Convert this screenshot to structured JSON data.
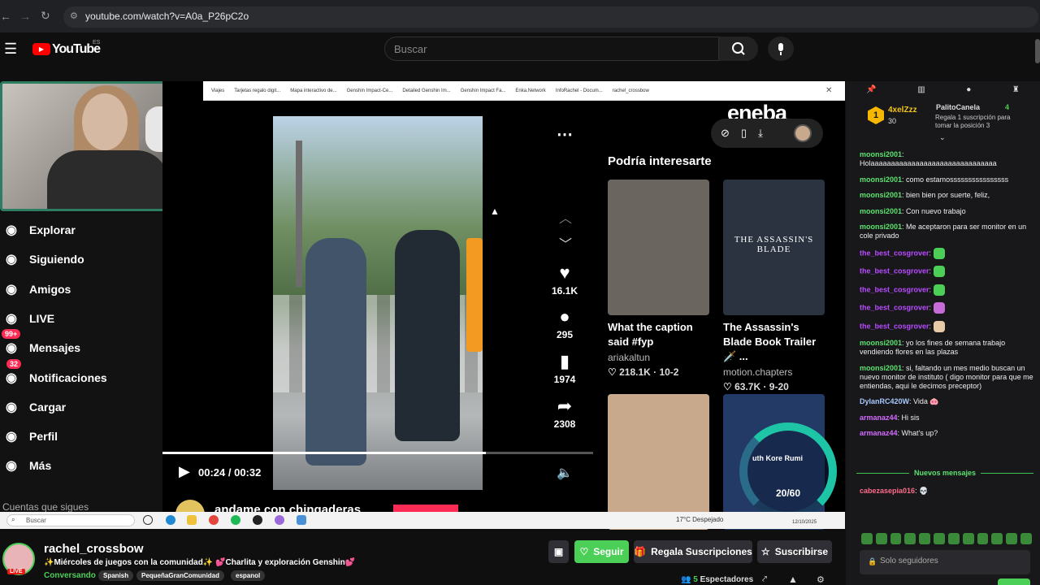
{
  "browser": {
    "url": "youtube.com/watch?v=A0a_P26pC2o"
  },
  "youtube": {
    "logo": "YouTube",
    "country": "ES",
    "search_placeholder": "Buscar"
  },
  "tiktok": {
    "nav": [
      {
        "label": "Explorar",
        "icon": "compass-icon"
      },
      {
        "label": "Siguiendo",
        "icon": "user-plus-icon"
      },
      {
        "label": "Amigos",
        "icon": "users-icon"
      },
      {
        "label": "LIVE",
        "icon": "live-tv-icon"
      },
      {
        "label": "Mensajes",
        "icon": "message-icon",
        "badge": "99+"
      },
      {
        "label": "Notificaciones",
        "icon": "inbox-icon",
        "badge": "32"
      },
      {
        "label": "Cargar",
        "icon": "plus-square-icon"
      },
      {
        "label": "Perfil",
        "icon": "avatar-icon"
      },
      {
        "label": "Más",
        "icon": "more-icon"
      }
    ],
    "followed_label": "Cuentas que sigues",
    "bookmarks": [
      "Viajes",
      "Tarjetas regalo digit...",
      "Mapa interactivo de...",
      "Genshin Impact-Ce...",
      "Detailed Genshin Im...",
      "Genshin Impact Fa...",
      "Enka.Network",
      "InfoRachel - Docum...",
      "rachel_crossbow"
    ],
    "video": {
      "time": "00:24 / 00:32",
      "progress": 0.75
    },
    "actions": {
      "likes": "16.1K",
      "comments": "295",
      "saves": "1974",
      "shares": "2308"
    },
    "next_author": "andame con chingaderas",
    "eneba": "eneba",
    "rec_title": "Podría interesarte",
    "recs": [
      {
        "title": "What the caption said #fyp",
        "author": "ariakaltun",
        "stats": "♡ 218.1K · 10-2",
        "thumb_color": "#6b6560"
      },
      {
        "title": "The Assassin's Blade Book Trailer 🗡️ ...",
        "author": "motion.chapters",
        "stats": "♡ 63.7K · 9-20",
        "thumb_color": "#2b3340",
        "thumb_text": "THE ASSASSIN'S BLADE"
      },
      {
        "title": "",
        "author": "",
        "stats": "",
        "thumb_color": "#c9a98c"
      },
      {
        "title": "",
        "author": "",
        "stats": "",
        "thumb_color": "#233a66"
      }
    ],
    "widget": {
      "text": "uth Kore Rumi",
      "count": "20/60"
    }
  },
  "taskbar": {
    "search_placeholder": "Buscar",
    "weather": "17°C Despejado",
    "date": "12/10/2025"
  },
  "chat": {
    "leader": {
      "rank": "1",
      "name": "4xelZzz",
      "count": "30"
    },
    "pinned": {
      "name": "PalitoCanela",
      "count": "4",
      "desc": "Regala 1 suscripción para tomar la posición 3"
    },
    "messages": [
      {
        "user": "moonsi2001",
        "color": "#5ce26e",
        "text": "Holaaaaaaaaaaaaaaaaaaaaaaaaaaaaaaa"
      },
      {
        "user": "moonsi2001",
        "color": "#5ce26e",
        "text": "como estamossssssssssssssss"
      },
      {
        "user": "moonsi2001",
        "color": "#5ce26e",
        "text": "bien bien por suerte, feliz,"
      },
      {
        "user": "moonsi2001",
        "color": "#5ce26e",
        "text": "Con nuevo trabajo"
      },
      {
        "user": "moonsi2001",
        "color": "#5ce26e",
        "text": "Me aceptaron para ser monitor en un cole privado"
      },
      {
        "user": "the_best_cosgrover",
        "color": "#b84bff",
        "text": "",
        "emote": "#4ccf57"
      },
      {
        "user": "the_best_cosgrover",
        "color": "#b84bff",
        "text": "",
        "emote": "#4ccf57"
      },
      {
        "user": "the_best_cosgrover",
        "color": "#b84bff",
        "text": "",
        "emote": "#4ccf57"
      },
      {
        "user": "the_best_cosgrover",
        "color": "#b84bff",
        "text": "",
        "emote": "#c66bd8"
      },
      {
        "user": "the_best_cosgrover",
        "color": "#b84bff",
        "text": "",
        "emote": "#e8c9a8"
      },
      {
        "user": "moonsi2001",
        "color": "#5ce26e",
        "text": "yo los fines de semana trabajo vendiendo flores en las plazas"
      },
      {
        "user": "moonsi2001",
        "color": "#5ce26e",
        "text": "si, faltando un mes medio buscan un nuevo monitor de instituto ( digo monitor para que me entiendas, aqui le decimos preceptor)"
      },
      {
        "user": "DylanRC420W",
        "color": "#a8c8ff",
        "text": "Vida 🐽"
      },
      {
        "user": "armanaz44",
        "color": "#d36bff",
        "text": "Hi sis"
      },
      {
        "user": "armanaz44",
        "color": "#d36bff",
        "text": "What's up?"
      }
    ],
    "new_messages": "Nuevos mensajes",
    "last": {
      "user": "cabezasepia016",
      "color": "#ff6b8b",
      "text": "💀"
    },
    "input_placeholder": "Solo seguidores"
  },
  "stream": {
    "channel": "rachel_crossbow",
    "live": "LIVE",
    "title": "✨Miércoles de juegos con la comunidad✨ 💕Charlita y exploración Genshin💕",
    "category": "Conversando",
    "tags": [
      "Spanish",
      "PequeñaGranComunidad",
      "espanol"
    ],
    "follow": "Seguir",
    "gift": "Regala Suscripciones",
    "subscribe": "Suscribirse",
    "viewers": "5",
    "viewers_label": "Espectadores"
  }
}
